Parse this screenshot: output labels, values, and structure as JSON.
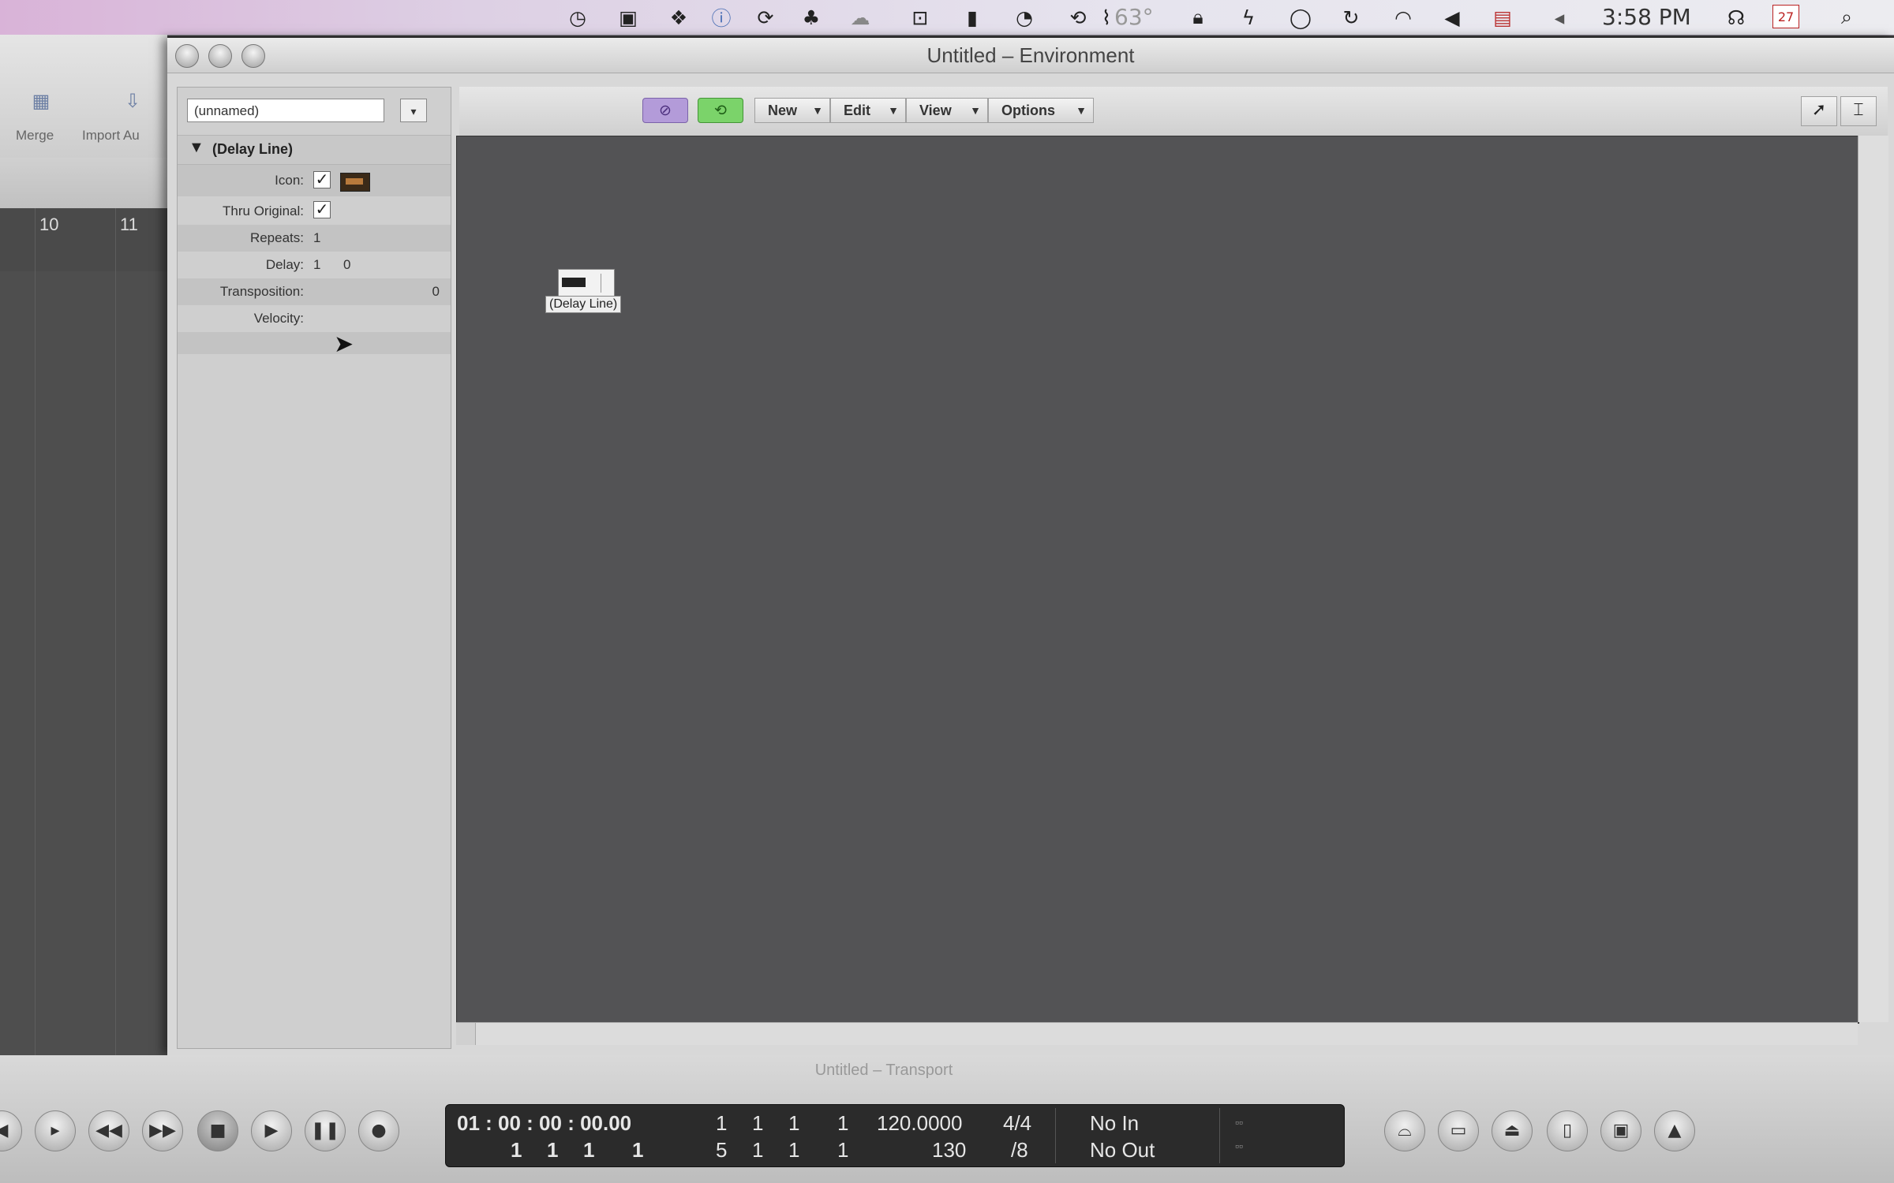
{
  "menubar": {
    "temperature": "63°",
    "clock": "3:58 PM",
    "calendar_day": "27",
    "icons": [
      "clock-icon",
      "video-icon",
      "dropbox-icon",
      "info-icon",
      "sync-icon",
      "evernote-icon",
      "cloud-icon",
      "screen-icon",
      "bookmark-icon",
      "pie-icon",
      "time-machine-icon",
      "lock-icon",
      "bolt-icon",
      "chat-icon",
      "refresh-icon",
      "wifi-icon",
      "volume-icon",
      "flag-icon",
      "input-icon",
      "headphones-icon",
      "calendar-icon",
      "search-icon"
    ]
  },
  "background_window": {
    "toolbar": {
      "merge_label": "Merge",
      "import_label": "Import Au"
    },
    "ruler": {
      "bar_10": "10",
      "bar_11": "11"
    }
  },
  "env_window": {
    "title": "Untitled – Environment",
    "inspector": {
      "object_name": "(unnamed)",
      "section_label": "(Delay Line)",
      "rows": {
        "icon_label": "Icon:",
        "thru_label": "Thru Original:",
        "repeats_label": "Repeats:",
        "repeats_value": "1",
        "delay_label": "Delay:",
        "delay_value_1": "1",
        "delay_value_2": "0",
        "transposition_label": "Transposition:",
        "transposition_value": "0",
        "velocity_label": "Velocity:"
      }
    },
    "toolbar": {
      "menus": [
        "New",
        "Edit",
        "View",
        "Options"
      ]
    },
    "canvas": {
      "object_label": "(Delay Line)"
    }
  },
  "transport": {
    "title": "Untitled – Transport",
    "smpte": "01 : 00 : 00 : 00.00",
    "smpte_bits": [
      "1",
      "1",
      "1",
      "1"
    ],
    "position_top": [
      "1",
      "1",
      "1",
      "1"
    ],
    "position_bottom": [
      "5",
      "1",
      "1",
      "1"
    ],
    "tempo": "120.0000",
    "tempo_bottom": "130",
    "signature": "4/4",
    "division": "/8",
    "midi_in": "No In",
    "midi_out": "No Out"
  }
}
